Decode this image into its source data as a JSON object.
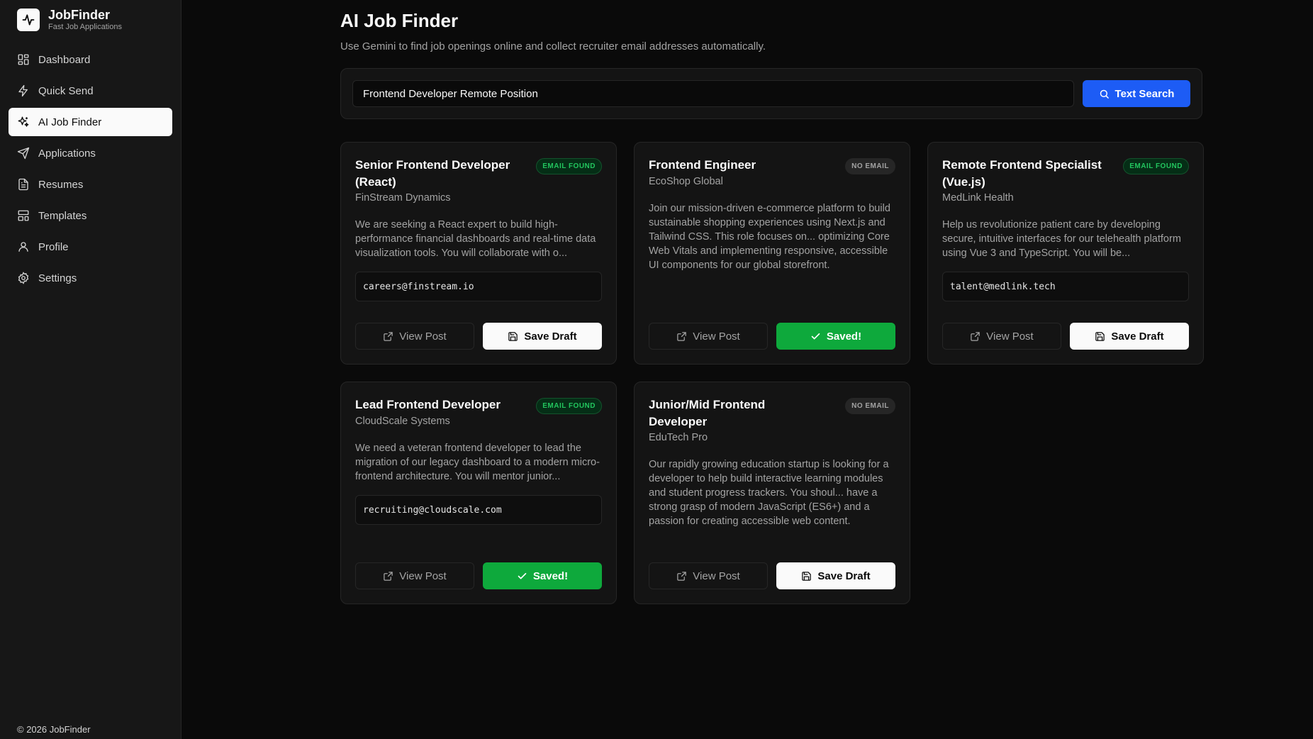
{
  "brand": {
    "name": "JobFinder",
    "subtitle": "Fast Job Applications"
  },
  "sidebar": {
    "items": [
      {
        "label": "Dashboard",
        "icon": "dashboard-icon"
      },
      {
        "label": "Quick Send",
        "icon": "lightning-icon"
      },
      {
        "label": "AI Job Finder",
        "icon": "sparkles-icon",
        "active": true
      },
      {
        "label": "Applications",
        "icon": "send-icon"
      },
      {
        "label": "Resumes",
        "icon": "document-icon"
      },
      {
        "label": "Templates",
        "icon": "templates-icon"
      },
      {
        "label": "Profile",
        "icon": "user-icon"
      },
      {
        "label": "Settings",
        "icon": "gear-icon"
      }
    ],
    "footer": "© 2026 JobFinder"
  },
  "page": {
    "title": "AI Job Finder",
    "description": "Use Gemini to find job openings online and collect recruiter email addresses automatically."
  },
  "search": {
    "value": "Frontend Developer Remote Position",
    "button_label": "Text Search"
  },
  "colors": {
    "accent": "#1d5cf5",
    "success": "#0ea93c",
    "badge_found": "#22c55e"
  },
  "jobs": [
    {
      "title": "Senior Frontend Developer (React)",
      "company": "FinStream Dynamics",
      "badge": "EMAIL FOUND",
      "description": "We are seeking a React expert to build high-performance financial dashboards and real-time data visualization tools. You will collaborate with o...",
      "email": "careers@finstream.io",
      "view_label": "View Post",
      "save_label": "Save Draft"
    },
    {
      "title": "Frontend Engineer",
      "company": "EcoShop Global",
      "badge": "NO EMAIL",
      "description": "Join our mission-driven e-commerce platform to build sustainable shopping experiences using Next.js and Tailwind CSS. This role focuses on... optimizing Core Web Vitals and implementing responsive, accessible UI components for our global storefront.",
      "email": "",
      "view_label": "View Post",
      "save_label": "Saved!"
    },
    {
      "title": "Remote Frontend Specialist (Vue.js)",
      "company": "MedLink Health",
      "badge": "EMAIL FOUND",
      "description": "Help us revolutionize patient care by developing secure, intuitive interfaces for our telehealth platform using Vue 3 and TypeScript. You will be...",
      "email": "talent@medlink.tech",
      "view_label": "View Post",
      "save_label": "Save Draft"
    },
    {
      "title": "Lead Frontend Developer",
      "company": "CloudScale Systems",
      "badge": "EMAIL FOUND",
      "description": "We need a veteran frontend developer to lead the migration of our legacy dashboard to a modern micro-frontend architecture. You will mentor junior...",
      "email": "recruiting@cloudscale.com",
      "view_label": "View Post",
      "save_label": "Saved!"
    },
    {
      "title": "Junior/Mid Frontend Developer",
      "company": "EduTech Pro",
      "badge": "NO EMAIL",
      "description": "Our rapidly growing education startup is looking for a developer to help build interactive learning modules and student progress trackers. You shoul... have a strong grasp of modern JavaScript (ES6+) and a passion for creating accessible web content.",
      "email": "",
      "view_label": "View Post",
      "save_label": "Save Draft"
    }
  ]
}
